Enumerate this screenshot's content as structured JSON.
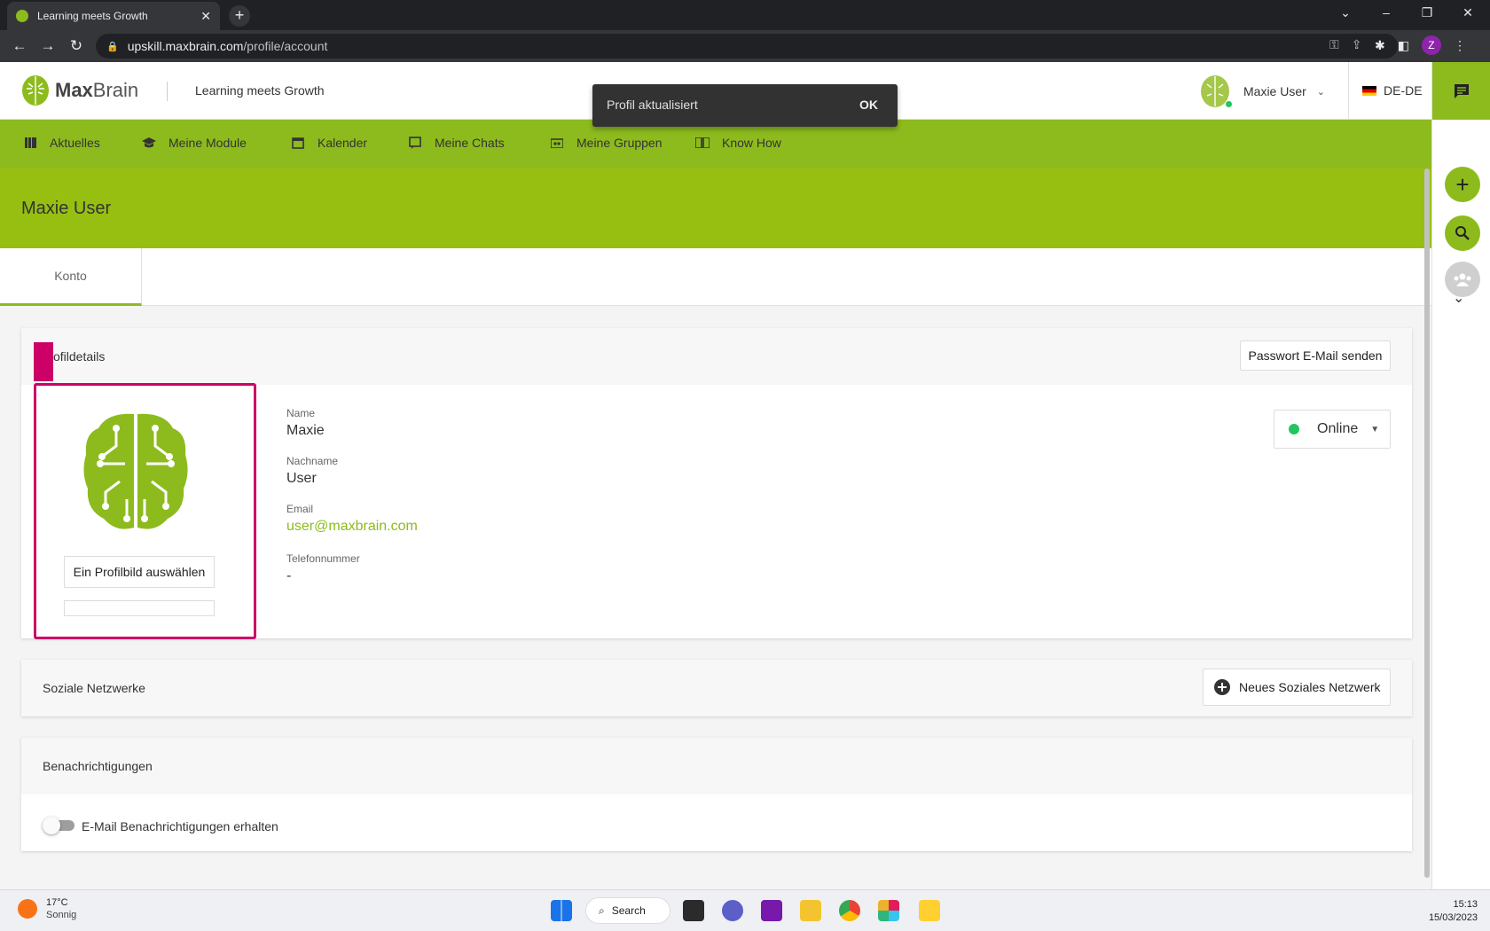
{
  "browser": {
    "tab_title": "Learning meets Growth",
    "url_host": "upskill.maxbrain.com",
    "url_path": "/profile/account",
    "profile_initial": "Z"
  },
  "header": {
    "brand_bold": "Max",
    "brand_light": "Brain",
    "tagline": "Learning meets Growth",
    "user_name": "Maxie User",
    "language": "DE-DE"
  },
  "toast": {
    "message": "Profil aktualisiert",
    "action": "OK"
  },
  "nav": {
    "items": [
      {
        "label": "Aktuelles",
        "icon": "library-icon"
      },
      {
        "label": "Meine Module",
        "icon": "graduation-cap-icon"
      },
      {
        "label": "Kalender",
        "icon": "calendar-icon"
      },
      {
        "label": "Meine Chats",
        "icon": "chat-icon"
      },
      {
        "label": "Meine Gruppen",
        "icon": "groups-icon"
      },
      {
        "label": "Know How",
        "icon": "book-icon"
      }
    ]
  },
  "page": {
    "title": "Maxie User",
    "tab": "Konto"
  },
  "profile": {
    "section_title": "Profildetails",
    "section_title_visible": "ofildetails",
    "password_button": "Passwort E-Mail senden",
    "choose_picture_button": "Ein Profilbild auswählen",
    "fields": {
      "name_label": "Name",
      "name_value": "Maxie",
      "lastname_label": "Nachname",
      "lastname_value": "User",
      "email_label": "Email",
      "email_value": "user@maxbrain.com",
      "phone_label": "Telefonnummer",
      "phone_value": "-"
    },
    "status": "Online"
  },
  "social": {
    "title": "Soziale Netzwerke",
    "add_button": "Neues Soziales Netzwerk"
  },
  "notifications": {
    "title": "Benachrichtigungen",
    "email_toggle_label": "E-Mail Benachrichtigungen erhalten",
    "email_toggle_on": false
  },
  "taskbar": {
    "temperature": "17°C",
    "weather": "Sonnig",
    "search_label": "Search",
    "time": "15:13",
    "date": "15/03/2023"
  },
  "colors": {
    "brand_green": "#8dbb1e",
    "highlight_pink": "#cc0066",
    "online_green": "#22c55e"
  }
}
